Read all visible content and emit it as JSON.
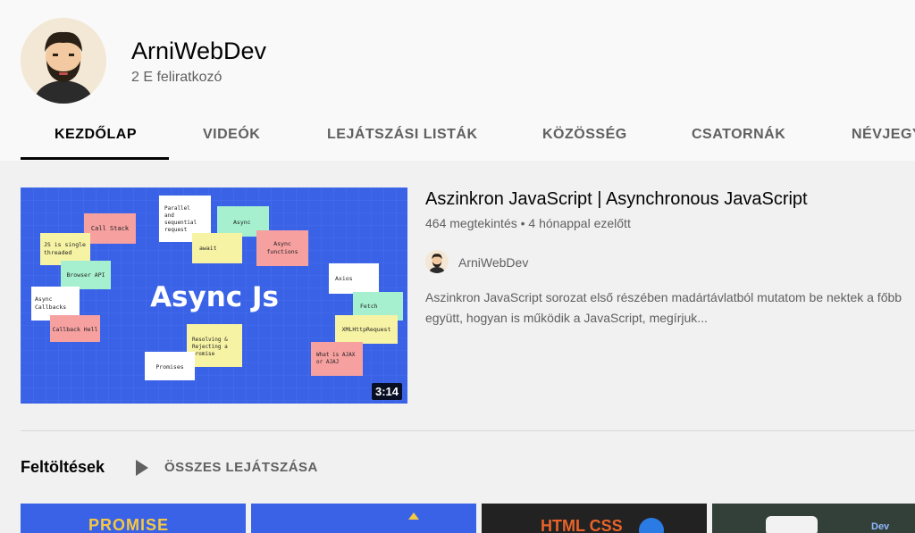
{
  "channel": {
    "name": "ArniWebDev",
    "subscribers": "2 E feliratkozó"
  },
  "tabs": [
    {
      "label": "KEZDŐLAP",
      "active": true
    },
    {
      "label": "VIDEÓK"
    },
    {
      "label": "LEJÁTSZÁSI LISTÁK"
    },
    {
      "label": "KÖZÖSSÉG"
    },
    {
      "label": "CSATORNÁK"
    },
    {
      "label": "NÉVJEGY"
    }
  ],
  "featured": {
    "title": "Aszinkron JavaScript | Asynchronous JavaScript",
    "meta": "464 megtekintés • 4 hónappal ezelőtt",
    "channel": "ArniWebDev",
    "description_line1": "Aszinkron JavaScript sorozat első részében madártávlatból mutatom be nektek a főbb",
    "description_line2": "együtt, hogyan is működik a JavaScript, megírjuk...",
    "duration": "3:14",
    "thumbnail": {
      "headline": "Async Js",
      "notes": [
        "Call Stack",
        "JS is single threaded",
        "Browser API",
        "Async Callbacks",
        "Callback Hell",
        "Parallel and sequential request",
        "Async",
        "await",
        "Async functions",
        "Axios",
        "Fetch",
        "XMLHttpRequest",
        "What is AJAX or AJAJ",
        "Resolving & Rejecting a promise",
        "Promises"
      ]
    }
  },
  "uploads": {
    "title": "Feltöltések",
    "play_all": "ÖSSZES LEJÁTSZÁSA",
    "thumbs": [
      "PROMISE",
      "",
      "HTML CSS",
      "Dev"
    ]
  },
  "colors": {
    "thumb_blue": "#3a62e6",
    "note_pink": "#f6a0a0",
    "note_yellow": "#f7f3a4",
    "note_green": "#a6f0d0",
    "note_white": "#ffffff"
  }
}
